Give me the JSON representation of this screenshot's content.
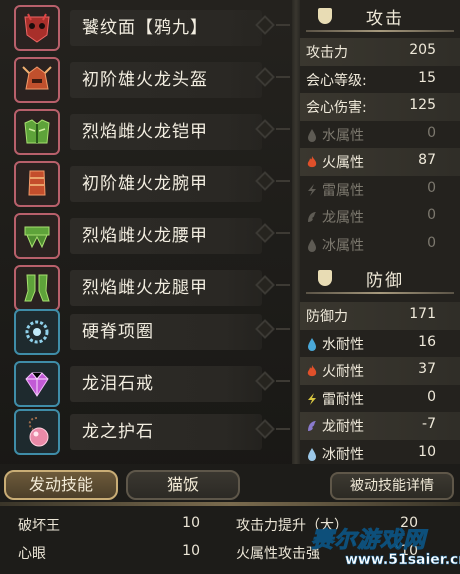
{
  "equipment": [
    {
      "name": "饕纹面【鸦九】",
      "icon": "mask-icon",
      "frame": "red"
    },
    {
      "name": "初阶雄火龙头盔",
      "icon": "helmet-icon",
      "frame": "red"
    },
    {
      "name": "烈焰雌火龙铠甲",
      "icon": "chest-armor-icon",
      "frame": "red"
    },
    {
      "name": "初阶雄火龙腕甲",
      "icon": "gauntlet-icon",
      "frame": "red"
    },
    {
      "name": "烈焰雌火龙腰甲",
      "icon": "waist-armor-icon",
      "frame": "red"
    },
    {
      "name": "烈焰雌火龙腿甲",
      "icon": "leg-armor-icon",
      "frame": "red"
    },
    {
      "name": "硬脊项圈",
      "icon": "necklace-icon",
      "frame": "blue"
    },
    {
      "name": "龙泪石戒",
      "icon": "gem-ring-icon",
      "frame": "blue"
    },
    {
      "name": "龙之护石",
      "icon": "amulet-icon",
      "frame": "blue"
    }
  ],
  "attack": {
    "title": "攻击",
    "rows": [
      {
        "label": "攻击力",
        "value": "205",
        "highlight": true,
        "dim": false,
        "icon": ""
      },
      {
        "label": "会心等级:",
        "value": "15",
        "highlight": false,
        "dim": false,
        "icon": ""
      },
      {
        "label": "会心伤害:",
        "value": "125",
        "highlight": true,
        "dim": false,
        "icon": ""
      },
      {
        "label": "水属性",
        "value": "0",
        "highlight": false,
        "dim": true,
        "icon": "water-icon"
      },
      {
        "label": "火属性",
        "value": "87",
        "highlight": true,
        "dim": false,
        "icon": "fire-icon"
      },
      {
        "label": "雷属性",
        "value": "0",
        "highlight": false,
        "dim": true,
        "icon": "thunder-icon"
      },
      {
        "label": "龙属性",
        "value": "0",
        "highlight": false,
        "dim": true,
        "icon": "dragon-icon"
      },
      {
        "label": "冰属性",
        "value": "0",
        "highlight": false,
        "dim": true,
        "icon": "ice-icon"
      }
    ]
  },
  "defense": {
    "title": "防御",
    "rows": [
      {
        "label": "防御力",
        "value": "171",
        "highlight": true,
        "dim": false,
        "icon": ""
      },
      {
        "label": "水耐性",
        "value": "16",
        "highlight": false,
        "dim": false,
        "icon": "water-icon"
      },
      {
        "label": "火耐性",
        "value": "37",
        "highlight": true,
        "dim": false,
        "icon": "fire-icon"
      },
      {
        "label": "雷耐性",
        "value": "0",
        "highlight": false,
        "dim": false,
        "icon": "thunder-icon"
      },
      {
        "label": "龙耐性",
        "value": "-7",
        "highlight": true,
        "dim": false,
        "icon": "dragon-icon"
      },
      {
        "label": "冰耐性",
        "value": "10",
        "highlight": false,
        "dim": false,
        "icon": "ice-icon"
      }
    ]
  },
  "tabs": {
    "active_skills": "发动技能",
    "cat_meal": "猫饭",
    "passive_details": "被动技能详情"
  },
  "skills": [
    {
      "name": "破坏王",
      "level": "10"
    },
    {
      "name": "心眼",
      "level": "10"
    },
    {
      "name": "攻击力提升（大）",
      "level": "20"
    },
    {
      "name": "火属性攻击强",
      "level": "10"
    }
  ],
  "watermark": {
    "title": "赛尔游戏网",
    "url": "www.51saier.cn"
  },
  "colors": {
    "fire": "#e0502a",
    "water": "#4aa8d8",
    "thunder": "#d8c640",
    "dragon": "#8a7acc",
    "ice": "#9cc8e8",
    "accent": "#c9ad76"
  }
}
